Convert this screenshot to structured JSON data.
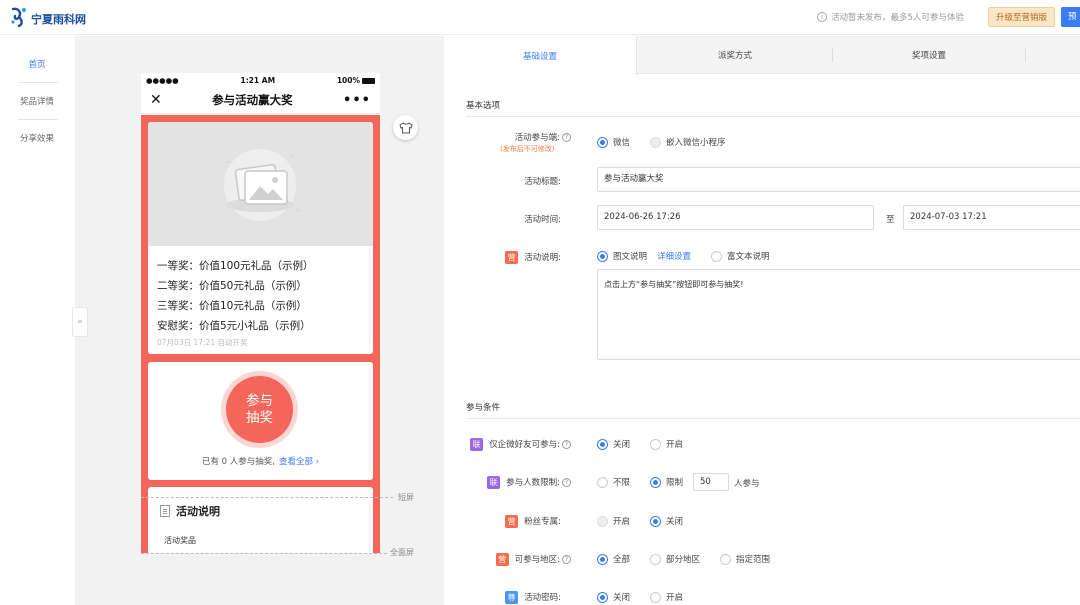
{
  "topbar": {
    "logo_text": "宁夏雨科网",
    "notice": "活动暂未发布，最多5人可参与体验",
    "upgrade_label": "升级至营销版",
    "preview_label": "预"
  },
  "leftnav": {
    "items": [
      "首页",
      "奖品详情",
      "分享效果"
    ]
  },
  "phone": {
    "status_signal": "●●●●●",
    "status_time": "1:21 AM",
    "status_battery": "100%",
    "title": "参与活动赢大奖",
    "prizes": [
      "一等奖：价值100元礼品（示例）",
      "二等奖：价值50元礼品（示例）",
      "三等奖：价值10元礼品（示例）",
      "安慰奖：价值5元小礼品（示例）"
    ],
    "draw_time": "07月03日 17:21 自动开奖",
    "draw_button_line1": "参与",
    "draw_button_line2": "抽奖",
    "joined_text": "已有 0 人参与抽奖,",
    "view_all": "查看全部 ›",
    "desc_title": "活动说明",
    "desc_sub": "活动奖品"
  },
  "guides": {
    "short_screen": "短屏",
    "full_screen": "全面屏"
  },
  "tabs": [
    {
      "label": "基础设置",
      "active": true
    },
    {
      "label": "派奖方式",
      "active": false
    },
    {
      "label": "奖项设置",
      "active": false
    }
  ],
  "basic": {
    "section_title": "基本选项",
    "platform_label": "活动参与端:",
    "platform_note": "(发布后不可修改)",
    "platform_options": [
      "微信",
      "嵌入微信小程序"
    ],
    "title_label": "活动标题:",
    "title_value": "参与活动赢大奖",
    "time_label": "活动时间:",
    "time_start": "2024-06-26 17:26",
    "time_to": "至",
    "time_end": "2024-07-03 17:21",
    "desc_label": "活动说明:",
    "desc_options": [
      "图文说明",
      "富文本说明"
    ],
    "desc_detail_link": "详细设置",
    "desc_text": "点击上方“参与抽奖”按钮即可参与抽奖!"
  },
  "conditions": {
    "section_title": "参与条件",
    "friend_label": "仅企微好友可参与:",
    "friend_options": [
      "关闭",
      "开启"
    ],
    "limit_label": "参与人数限制:",
    "limit_options": [
      "不限",
      "限制"
    ],
    "limit_value": "50",
    "limit_unit": "人参与",
    "fans_label": "粉丝专属:",
    "fans_options": [
      "开启",
      "关闭"
    ],
    "region_label": "可参与地区:",
    "region_options": [
      "全部",
      "部分地区",
      "指定范围"
    ],
    "password_label": "活动密码:",
    "password_options": [
      "关闭",
      "开启"
    ]
  },
  "badges": {
    "ying": "营",
    "lian": "联",
    "zun": "尊"
  },
  "colors": {
    "accent": "#3a7cf4",
    "red": "#f3665a",
    "orange_badge": "#f56c4f",
    "purple_badge": "#9967e8",
    "blue_badge": "#4a96f5"
  }
}
